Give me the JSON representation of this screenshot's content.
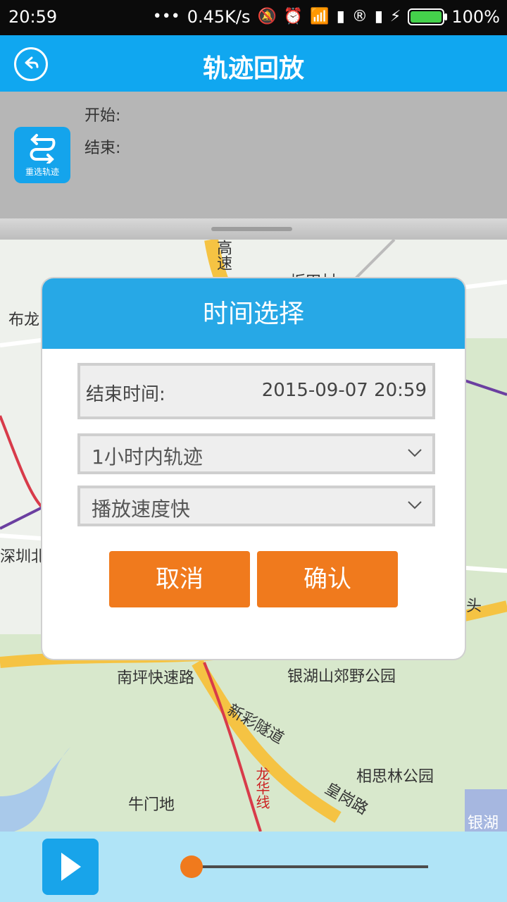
{
  "status_bar": {
    "time": "20:59",
    "network_speed": "0.45K/s",
    "battery_percent": "100%",
    "icons": [
      "dots-icon",
      "mute-icon",
      "alarm-icon",
      "wifi-icon",
      "signal-icon",
      "roaming-icon",
      "signal-icon-2",
      "charging-icon",
      "battery-icon"
    ]
  },
  "titlebar": {
    "title": "轨迹回放",
    "back_icon": "back-icon"
  },
  "info_panel": {
    "start_label": "开始:",
    "end_label": "结束:",
    "reselect_label": "重选轨迹"
  },
  "map": {
    "labels": [
      "高速",
      "坂田村",
      "布龙",
      "深圳北",
      "头",
      "南坪快速路",
      "银湖山郊野公园",
      "新彩隧道",
      "相思林公园",
      "龙华线",
      "牛门地",
      "皇岗路",
      "银湖"
    ]
  },
  "dialog": {
    "title": "时间选择",
    "end_time_label": "结束时间:",
    "end_time_value": "2015-09-07 20:59",
    "range_select_value": "1小时内轨迹",
    "speed_select_value": "播放速度快",
    "cancel_label": "取消",
    "confirm_label": "确认"
  },
  "player": {
    "progress": 0.0
  },
  "colors": {
    "titlebar": "#10a7f0",
    "accent_orange": "#f07a1d",
    "player_bg": "#b0e4f7"
  }
}
